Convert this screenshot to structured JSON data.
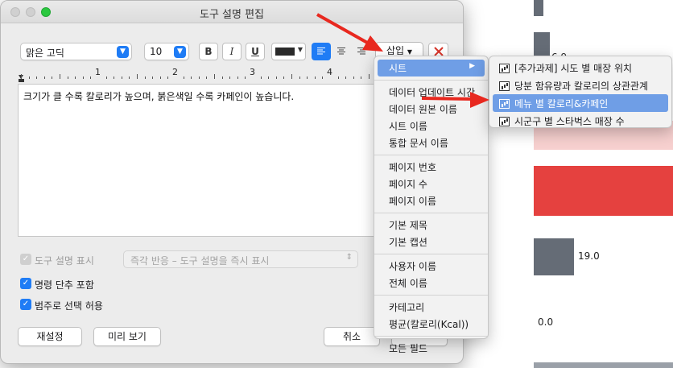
{
  "dialog": {
    "title": "도구 설명 편집",
    "font_name": "맑은 고딕",
    "font_size": "10",
    "bold_label": "B",
    "italic_label": "I",
    "underline_label": "U",
    "insert_label": "삽입",
    "ruler_numbers": [
      "1",
      "2",
      "3",
      "4"
    ],
    "tooltip_text": "크기가 클 수록 칼로리가 높으며, 붉은색일 수록 카페인이 높습니다.",
    "show_tooltip_label": "도구 설명 표시",
    "tooltip_mode": "즉각 반응 – 도구 설명을 즉시 표시",
    "include_command_buttons_label": "명령 단추 포함",
    "allow_selection_by_category_label": "범주로 선택 허용",
    "reset_label": "재설정",
    "preview_label": "미리 보기",
    "cancel_label": "취소"
  },
  "insert_menu": {
    "sheet_label": "시트",
    "groups": [
      [
        "데이터 업데이트 시간",
        "데이터 원본 이름",
        "시트 이름",
        "통합 문서 이름"
      ],
      [
        "페이지 번호",
        "페이지 수",
        "페이지 이름"
      ],
      [
        "기본 제목",
        "기본 캡션"
      ],
      [
        "사용자 이름",
        "전체 이름"
      ],
      [
        "카테고리",
        "평균(칼로리(Kcal))"
      ],
      [
        "모든 필드"
      ]
    ]
  },
  "sheet_submenu": {
    "items": [
      "[추가과제] 시도 별 매장 위치",
      "당분 함유량과 칼로리의 상관관계",
      "메뉴 별 칼로리&카페인",
      "시군구 별 스타벅스 매장 수"
    ],
    "highlighted_index": 2
  },
  "background": {
    "labels": [
      "6.9",
      "19.0",
      "0.0"
    ]
  },
  "colors": {
    "accent": "#1f7cf5",
    "menu_highlight": "#6f9ee6",
    "bar_red": "#e5413f",
    "bar_pink": "#f7d0cf",
    "bar_gray": "#656c76",
    "arrow_red": "#e8281f"
  }
}
